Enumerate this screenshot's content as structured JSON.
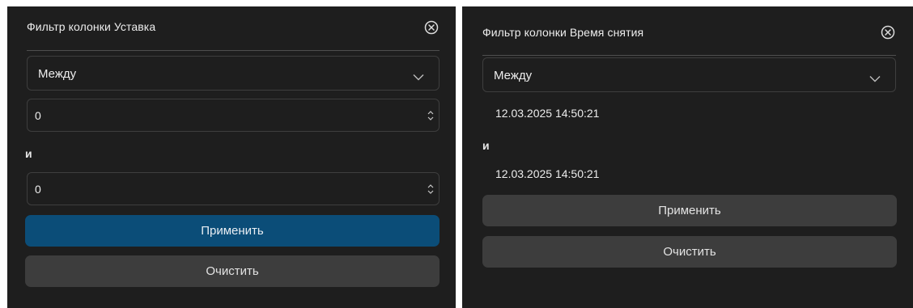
{
  "left_panel": {
    "title": "Фильтр колонки Уставка",
    "operator": "Между",
    "from_value": "0",
    "and_label": "и",
    "to_value": "0",
    "apply_label": "Применить",
    "clear_label": "Очистить"
  },
  "right_panel": {
    "title": "Фильтр колонки Время снятия",
    "operator": "Между",
    "from_value": "12.03.2025 14:50:21",
    "and_label": "и",
    "to_value": "12.03.2025 14:50:21",
    "apply_label": "Применить",
    "clear_label": "Очистить"
  },
  "icons": {
    "close": "circle-x-icon",
    "dropdown": "chevron-down-icon",
    "spinner": "up-down-spinner-icon"
  },
  "colors": {
    "panel_bg": "#1e1e1e",
    "primary_button": "#0b4d78",
    "secondary_button": "#3d3d3d",
    "border": "#3e3e3e"
  }
}
